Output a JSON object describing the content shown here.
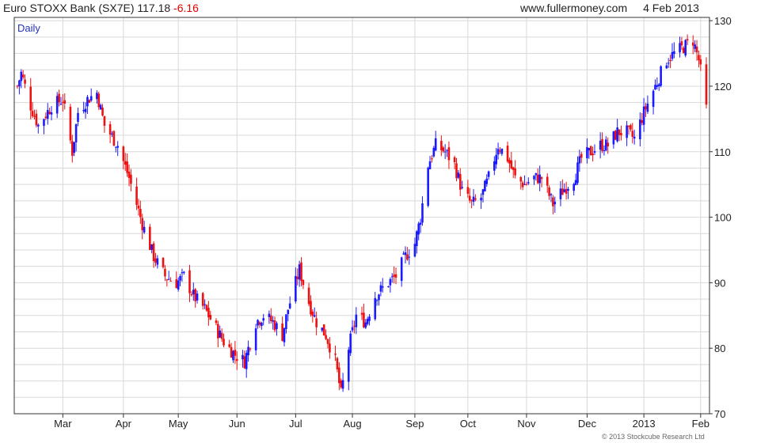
{
  "header": {
    "instrument": "Euro STOXX Bank (SX7E)",
    "last": "117.18",
    "change": "-6.16",
    "site": "www.fullermoney.com",
    "date": "4 Feb 2013"
  },
  "period_label": "Daily",
  "copyright": "© 2013 Stockcube Research Ltd",
  "colors": {
    "up": "#1a1aff",
    "down": "#ee1111",
    "grid": "#d8d8d8",
    "axis": "#333333"
  },
  "chart_data": {
    "type": "candlestick",
    "x_tick_labels": [
      "Mar",
      "Apr",
      "May",
      "Jun",
      "Jul",
      "Aug",
      "Sep",
      "Oct",
      "Nov",
      "Dec",
      "2013",
      "Feb"
    ],
    "y_ticks": [
      70,
      80,
      90,
      100,
      110,
      120,
      130
    ],
    "ylim": [
      70,
      130.5
    ],
    "y_axis_position": "right",
    "grid": true,
    "x_start": "2012-02-06",
    "x_end": "2013-02-04",
    "anchors": [
      [
        "2012-02-06",
        120
      ],
      [
        "2012-02-08",
        122
      ],
      [
        "2012-02-13",
        117
      ],
      [
        "2012-02-17",
        114
      ],
      [
        "2012-02-24",
        117
      ],
      [
        "2012-03-01",
        118
      ],
      [
        "2012-03-06",
        110
      ],
      [
        "2012-03-09",
        116
      ],
      [
        "2012-03-14",
        118
      ],
      [
        "2012-03-19",
        119
      ],
      [
        "2012-03-23",
        114
      ],
      [
        "2012-03-30",
        111
      ],
      [
        "2012-04-05",
        106
      ],
      [
        "2012-04-12",
        99
      ],
      [
        "2012-04-18",
        94
      ],
      [
        "2012-04-24",
        91
      ],
      [
        "2012-04-30",
        90
      ],
      [
        "2012-05-04",
        91
      ],
      [
        "2012-05-09",
        88
      ],
      [
        "2012-05-15",
        86
      ],
      [
        "2012-05-21",
        83
      ],
      [
        "2012-05-25",
        81
      ],
      [
        "2012-05-31",
        79
      ],
      [
        "2012-06-05",
        78
      ],
      [
        "2012-06-11",
        84
      ],
      [
        "2012-06-15",
        85
      ],
      [
        "2012-06-20",
        84
      ],
      [
        "2012-06-25",
        82
      ],
      [
        "2012-06-28",
        86
      ],
      [
        "2012-07-04",
        92
      ],
      [
        "2012-07-09",
        87
      ],
      [
        "2012-07-13",
        84
      ],
      [
        "2012-07-18",
        82
      ],
      [
        "2012-07-23",
        78
      ],
      [
        "2012-07-26",
        73
      ],
      [
        "2012-07-30",
        80
      ],
      [
        "2012-08-03",
        85
      ],
      [
        "2012-08-08",
        84
      ],
      [
        "2012-08-13",
        88
      ],
      [
        "2012-08-20",
        90
      ],
      [
        "2012-08-24",
        91
      ],
      [
        "2012-08-29",
        94
      ],
      [
        "2012-09-03",
        96
      ],
      [
        "2012-09-06",
        100
      ],
      [
        "2012-09-10",
        108
      ],
      [
        "2012-09-14",
        111
      ],
      [
        "2012-09-19",
        110
      ],
      [
        "2012-09-24",
        108
      ],
      [
        "2012-09-28",
        104
      ],
      [
        "2012-10-03",
        102
      ],
      [
        "2012-10-08",
        103
      ],
      [
        "2012-10-12",
        106
      ],
      [
        "2012-10-17",
        111
      ],
      [
        "2012-10-22",
        109
      ],
      [
        "2012-10-26",
        106
      ],
      [
        "2012-10-31",
        105
      ],
      [
        "2012-11-05",
        106
      ],
      [
        "2012-11-09",
        106
      ],
      [
        "2012-11-15",
        102
      ],
      [
        "2012-11-20",
        104
      ],
      [
        "2012-11-26",
        106
      ],
      [
        "2012-11-30",
        109
      ],
      [
        "2012-12-05",
        110
      ],
      [
        "2012-12-10",
        111
      ],
      [
        "2012-12-14",
        111
      ],
      [
        "2012-12-19",
        113
      ],
      [
        "2012-12-24",
        113
      ],
      [
        "2012-12-28",
        112
      ],
      [
        "2013-01-02",
        116
      ],
      [
        "2013-01-08",
        120
      ],
      [
        "2013-01-14",
        124
      ],
      [
        "2013-01-18",
        125
      ],
      [
        "2013-01-23",
        126
      ],
      [
        "2013-01-28",
        127
      ],
      [
        "2013-01-31",
        124
      ],
      [
        "2013-02-04",
        117.18
      ]
    ]
  }
}
